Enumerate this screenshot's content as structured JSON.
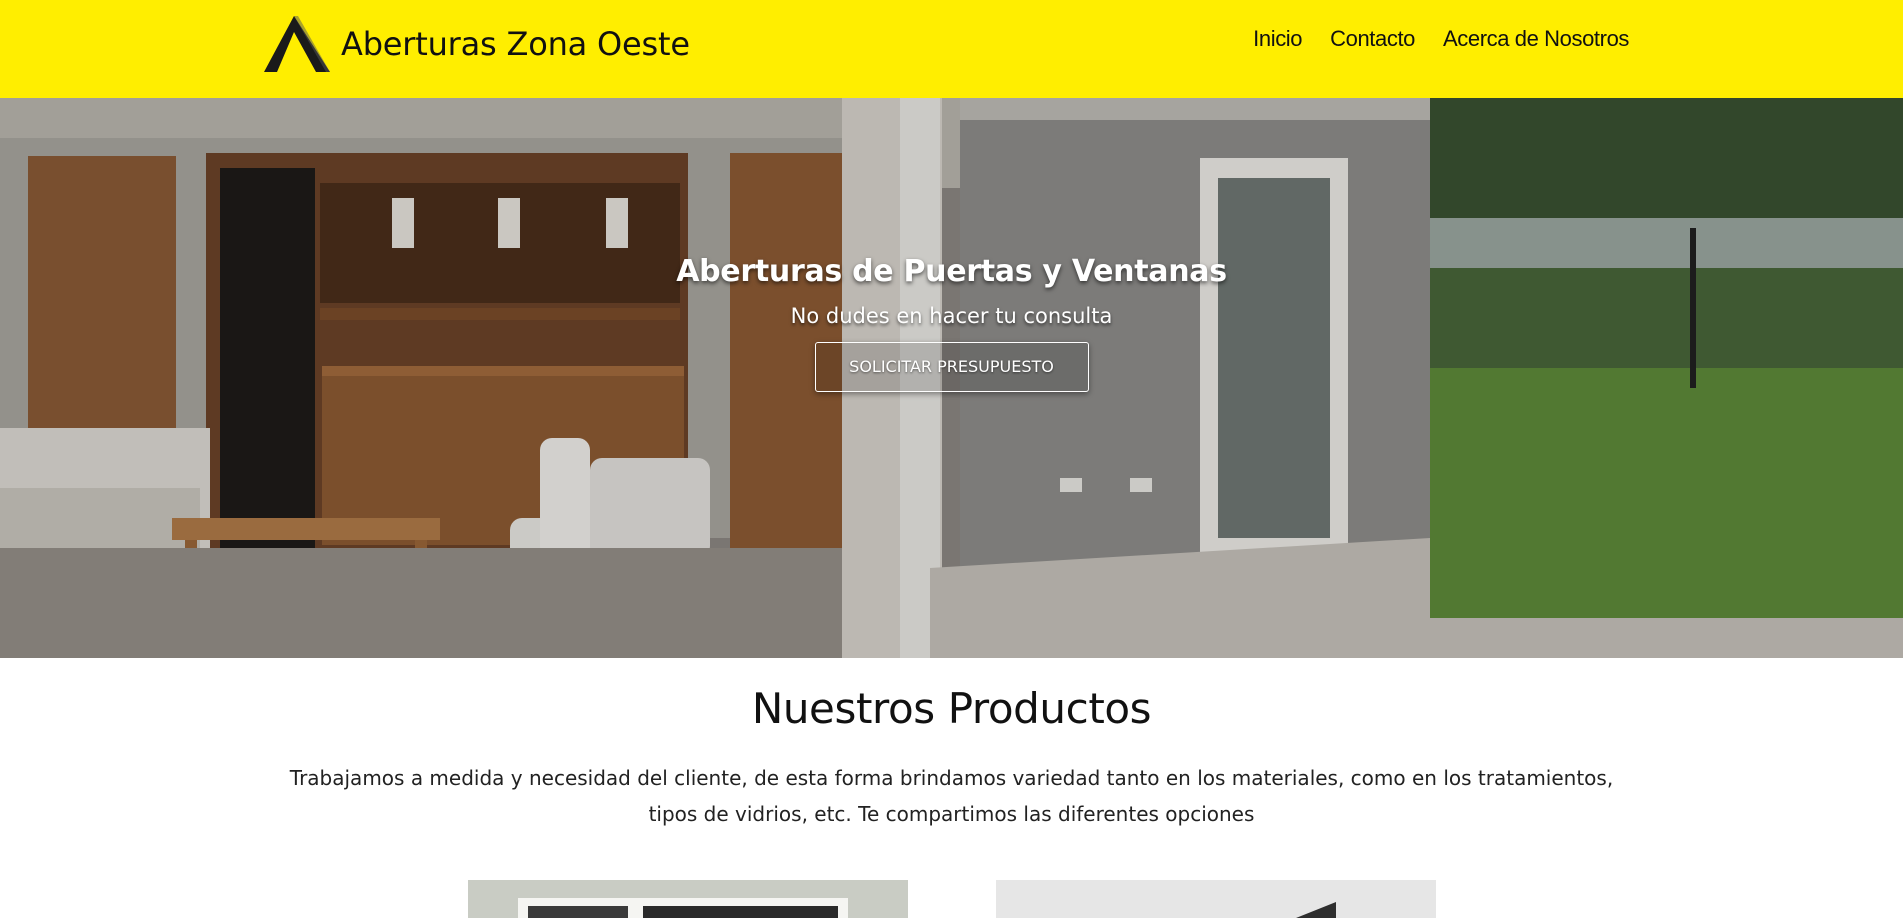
{
  "header": {
    "brand_name": "Aberturas Zona Oeste",
    "logo_icon": "triangle-logo-icon",
    "nav": [
      {
        "label": "Inicio"
      },
      {
        "label": "Contacto"
      },
      {
        "label": "Acerca de Nosotros"
      }
    ]
  },
  "hero": {
    "title": "Aberturas de Puertas y Ventanas",
    "subtitle": "No dudes en hacer tu consulta",
    "cta_label": "SOLICITAR PRESUPUESTO"
  },
  "products": {
    "title": "Nuestros Productos",
    "description": "Trabajamos a medida y necesidad del cliente, de esta forma brindamos variedad tanto en los materiales, como en los tratamientos, tipos de vidrios, etc. Te compartimos las diferentes opciones"
  },
  "colors": {
    "header_bg": "#ffee00",
    "text": "#111111"
  }
}
